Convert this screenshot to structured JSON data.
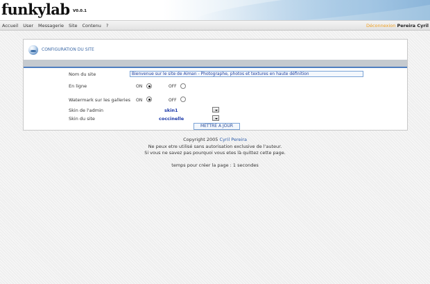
{
  "header": {
    "logo": "funkylab",
    "version": "V0.0.1"
  },
  "nav": {
    "items": [
      "Accueil",
      "User",
      "Messagerie",
      "Site",
      "Contenu",
      "?"
    ],
    "logout": "Déconnexion",
    "username": "Pereira Cyril"
  },
  "panel": {
    "title": "CONFIGURATION DU SITE",
    "fields": {
      "site_name_label": "Nom du site",
      "site_name_value": "Bienvenue sur le site de Aiman - Photographe, photos et textures en haute définition",
      "online_label": "En ligne",
      "online_on": "ON",
      "online_off": "OFF",
      "online_selected": "ON",
      "watermark_label": "Watermark sur les galleries",
      "watermark_on": "ON",
      "watermark_off": "OFF",
      "watermark_selected": "ON",
      "admin_skin_label": "Skin de l'admin",
      "admin_skin_value": "skin1",
      "site_skin_label": "Skin du site",
      "site_skin_value": "coccinelle"
    },
    "submit_label": "METTRE A JOUR"
  },
  "footer": {
    "copyright_prefix": "Copyright 2005",
    "author": "Cyril Pereira",
    "line2": "Ne peux etre utilisé sans autorisation exclusive de l'auteur.",
    "line3": "Si vous ne savez pas pourquoi vous etes là quittez cette page.",
    "timing": "temps pour créer la page : 1 secondes"
  },
  "colors": {
    "accent": "#4f7fc0",
    "logout": "#f0a020",
    "link": "#2b5aa8",
    "skin_value": "#1a37a8"
  }
}
